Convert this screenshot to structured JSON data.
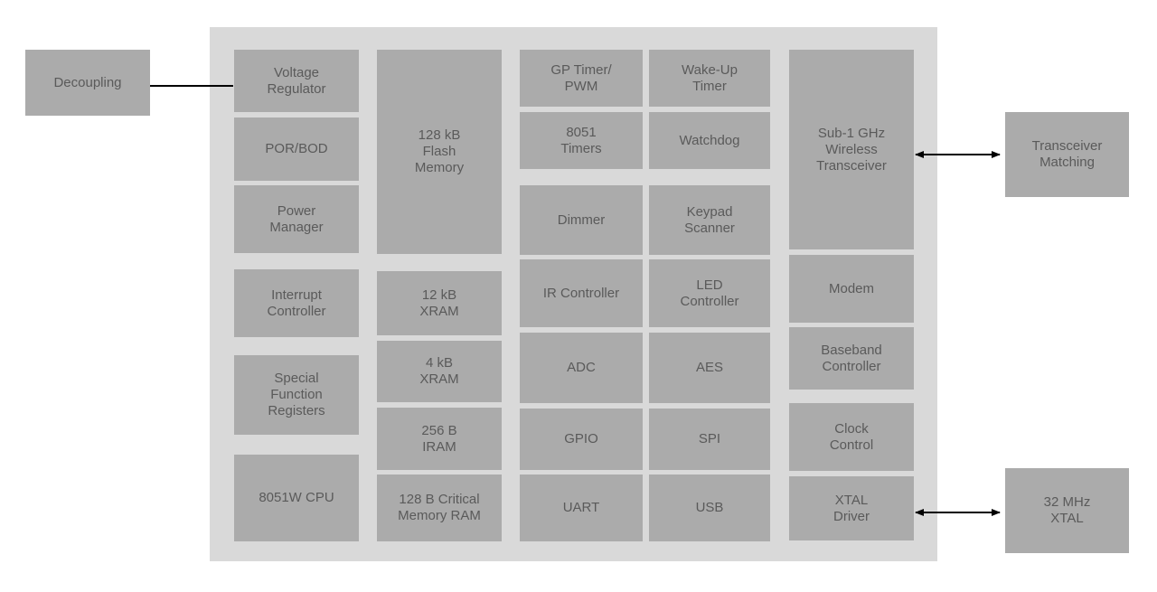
{
  "external": {
    "decoupling": "Decoupling",
    "transceiver_matching": "Transceiver\nMatching",
    "xtal": "32 MHz\nXTAL"
  },
  "chip": {
    "col1": [
      "Voltage\nRegulator",
      "POR/BOD",
      "Power\nManager",
      "Interrupt\nController",
      "Special\nFunction\nRegisters",
      "8051W CPU"
    ],
    "col2": [
      "128 kB\nFlash\nMemory",
      "12 kB\nXRAM",
      "4 kB\nXRAM",
      "256 B\nIRAM",
      "128 B Critical\nMemory RAM"
    ],
    "col3": [
      "GP Timer/\nPWM",
      "8051\nTimers",
      "Dimmer",
      "IR Controller",
      "ADC",
      "GPIO",
      "UART"
    ],
    "col4": [
      "Wake-Up\nTimer",
      "Watchdog",
      "Keypad\nScanner",
      "LED\nController",
      "AES",
      "SPI",
      "USB"
    ],
    "col5": [
      "Sub-1 GHz\nWireless\nTransceiver",
      "Modem",
      "Baseband\nController",
      "Clock\nControl",
      "XTAL\nDriver"
    ]
  },
  "colors": {
    "chip_bg": "#d9d9d9",
    "block": "#ababab",
    "text": "#5a5a5a",
    "connector": "#000000"
  }
}
